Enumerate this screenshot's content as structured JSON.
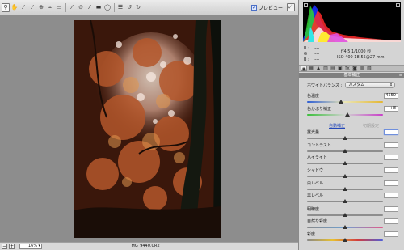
{
  "toolbar": {
    "icons": [
      "zoom-icon",
      "hand-icon",
      "white-balance-icon",
      "color-sampler-icon",
      "targeted-adjustment-icon",
      "crop-icon",
      "straighten-icon",
      "spot-removal-icon",
      "red-eye-icon",
      "adjustment-brush-icon",
      "graduated-filter-icon",
      "radial-filter-icon",
      "preferences-icon",
      "rotate-ccw-icon",
      "rotate-cw-icon"
    ],
    "preview_label": "プレビュー",
    "preview_checked": true
  },
  "image": {
    "filename": "_MG_9440.CR2",
    "zoom": "16%"
  },
  "histogram": {
    "r_label": "R :",
    "g_label": "G :",
    "b_label": "B :",
    "r_value": "----",
    "g_value": "----",
    "b_value": "----",
    "aperture_shutter": "f/4.5   1/1000 秒",
    "iso_lens": "ISO 400   18-55@27 mm"
  },
  "panel": {
    "section_title": "基本補正",
    "white_balance_label": "ホワイトバランス :",
    "white_balance_value": "カスタム",
    "auto_label": "自動補正",
    "default_label": "初期設定"
  },
  "controls": [
    {
      "label": "色温度",
      "value": "4550",
      "position": 0.45,
      "track": "temp"
    },
    {
      "label": "色かぶり補正",
      "value": "+8",
      "position": 0.53,
      "track": "tint"
    },
    {
      "label": "露光量",
      "value": "",
      "position": 0.5,
      "track": "plain"
    },
    {
      "label": "コントラスト",
      "value": "",
      "position": 0.5,
      "track": "plain"
    },
    {
      "label": "ハイライト",
      "value": "",
      "position": 0.5,
      "track": "plain"
    },
    {
      "label": "シャドウ",
      "value": "",
      "position": 0.5,
      "track": "plain"
    },
    {
      "label": "白レベル",
      "value": "",
      "position": 0.5,
      "track": "plain"
    },
    {
      "label": "黒レベル",
      "value": "",
      "position": 0.5,
      "track": "plain"
    },
    {
      "label": "明瞭度",
      "value": "",
      "position": 0.5,
      "track": "plain"
    },
    {
      "label": "自然な彩度",
      "value": "",
      "position": 0.5,
      "track": "vib"
    },
    {
      "label": "彩度",
      "value": "",
      "position": 0.5,
      "track": "sat"
    }
  ],
  "colors": {
    "accent": "#2447b8",
    "panel_bg": "#d4d4d4",
    "canvas_bg": "#8d8d8d"
  }
}
